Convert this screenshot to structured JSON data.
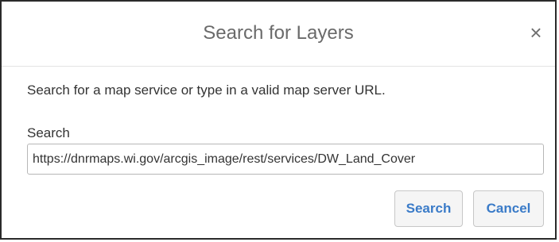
{
  "dialog": {
    "title": "Search for Layers",
    "close_glyph": "×",
    "close_icon": "close-icon"
  },
  "body": {
    "instructions": "Search for a map service or type in a valid map server URL.",
    "search_label": "Search",
    "search_value": "https://dnrmaps.wi.gov/arcgis_image/rest/services/DW_Land_Cover",
    "search_placeholder": ""
  },
  "buttons": {
    "search_label": "Search",
    "cancel_label": "Cancel"
  },
  "colors": {
    "button_text": "#3a7bc8",
    "title_text": "#6a6a6a"
  }
}
